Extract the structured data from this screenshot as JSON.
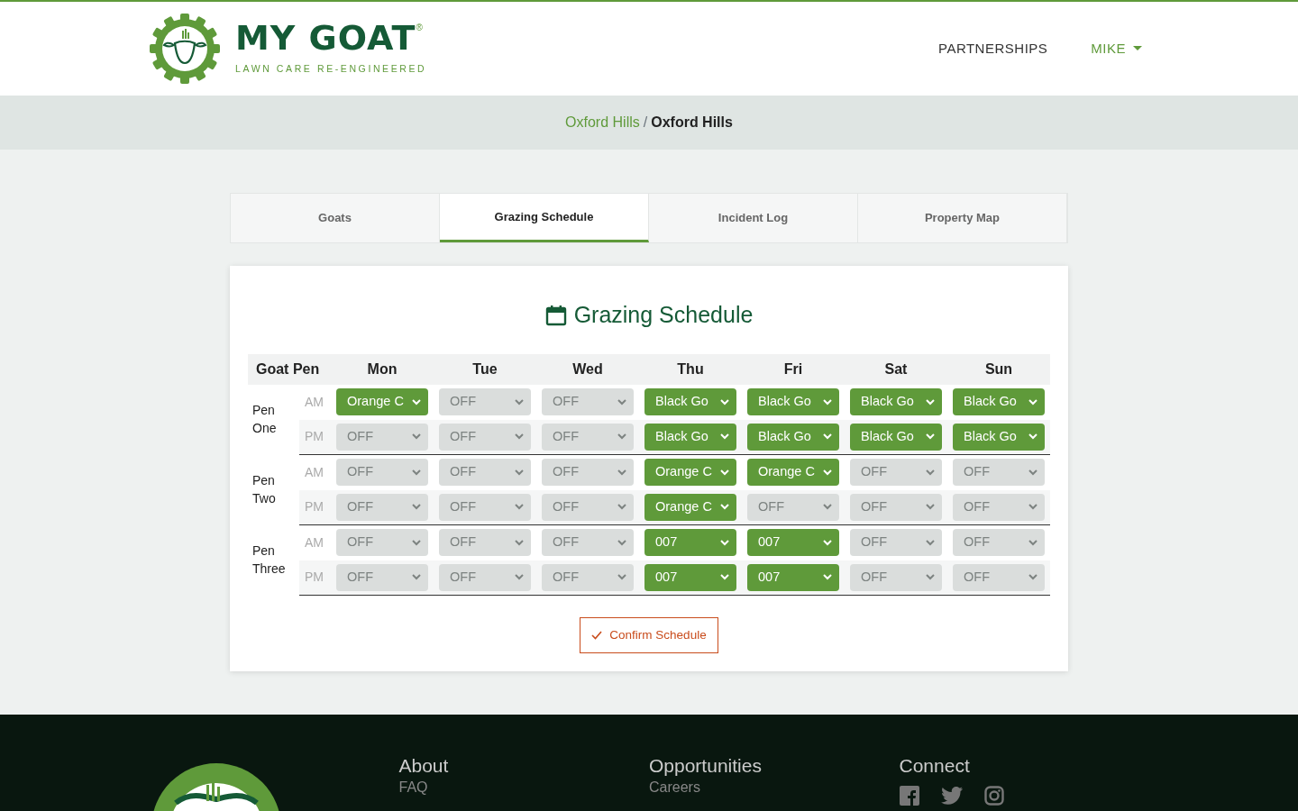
{
  "brand": {
    "name": "MY GOAT",
    "registered": "®",
    "tagline": "LAWN CARE RE-ENGINEERED"
  },
  "nav": [
    {
      "label": "PARTNERSHIPS",
      "kind": "link"
    },
    {
      "label": "MIKE",
      "kind": "dropdown"
    }
  ],
  "breadcrumb": [
    {
      "label": "Oxford Hills",
      "kind": "link"
    },
    {
      "label": "/",
      "kind": "separator"
    },
    {
      "label": "Oxford Hills",
      "kind": "current"
    }
  ],
  "tabs": [
    {
      "label": "Goats",
      "selected": false
    },
    {
      "label": "Grazing Schedule",
      "selected": true
    },
    {
      "label": "Incident Log",
      "selected": false
    },
    {
      "label": "Property Map",
      "selected": false
    }
  ],
  "schedule": {
    "title": "Grazing Schedule",
    "columns": [
      "Goat Pen",
      "Mon",
      "Tue",
      "Wed",
      "Thu",
      "Fri",
      "Sat",
      "Sun"
    ],
    "pens": [
      {
        "name": "Pen One",
        "slots": [
          {
            "period": "AM",
            "days": [
              {
                "value": "Orange C",
                "disabled": false
              },
              {
                "value": "OFF",
                "disabled": true
              },
              {
                "value": "OFF",
                "disabled": true
              },
              {
                "value": "Black Go",
                "disabled": false
              },
              {
                "value": "Black Go",
                "disabled": false
              },
              {
                "value": "Black Go",
                "disabled": false
              },
              {
                "value": "Black Go",
                "disabled": false
              }
            ]
          },
          {
            "period": "PM",
            "days": [
              {
                "value": "OFF",
                "disabled": true
              },
              {
                "value": "OFF",
                "disabled": true
              },
              {
                "value": "OFF",
                "disabled": true
              },
              {
                "value": "Black Go",
                "disabled": false
              },
              {
                "value": "Black Go",
                "disabled": false
              },
              {
                "value": "Black Go",
                "disabled": false
              },
              {
                "value": "Black Go",
                "disabled": false
              }
            ]
          }
        ]
      },
      {
        "name": "Pen Two",
        "slots": [
          {
            "period": "AM",
            "days": [
              {
                "value": "OFF",
                "disabled": true
              },
              {
                "value": "OFF",
                "disabled": true
              },
              {
                "value": "OFF",
                "disabled": true
              },
              {
                "value": "Orange C",
                "disabled": false
              },
              {
                "value": "Orange C",
                "disabled": false
              },
              {
                "value": "OFF",
                "disabled": true
              },
              {
                "value": "OFF",
                "disabled": true
              }
            ]
          },
          {
            "period": "PM",
            "days": [
              {
                "value": "OFF",
                "disabled": true
              },
              {
                "value": "OFF",
                "disabled": true
              },
              {
                "value": "OFF",
                "disabled": true
              },
              {
                "value": "Orange C",
                "disabled": false
              },
              {
                "value": "OFF",
                "disabled": true
              },
              {
                "value": "OFF",
                "disabled": true
              },
              {
                "value": "OFF",
                "disabled": true
              }
            ]
          }
        ]
      },
      {
        "name": "Pen Three",
        "slots": [
          {
            "period": "AM",
            "days": [
              {
                "value": "OFF",
                "disabled": true
              },
              {
                "value": "OFF",
                "disabled": true
              },
              {
                "value": "OFF",
                "disabled": true
              },
              {
                "value": "007",
                "disabled": false
              },
              {
                "value": "007",
                "disabled": false
              },
              {
                "value": "OFF",
                "disabled": true
              },
              {
                "value": "OFF",
                "disabled": true
              }
            ]
          },
          {
            "period": "PM",
            "days": [
              {
                "value": "OFF",
                "disabled": true
              },
              {
                "value": "OFF",
                "disabled": true
              },
              {
                "value": "OFF",
                "disabled": true
              },
              {
                "value": "007",
                "disabled": false
              },
              {
                "value": "007",
                "disabled": false
              },
              {
                "value": "OFF",
                "disabled": true
              },
              {
                "value": "OFF",
                "disabled": true
              }
            ]
          }
        ]
      }
    ],
    "confirm": "Confirm Schedule"
  },
  "footer": {
    "columns": [
      {
        "heading": "About",
        "links": [
          "FAQ"
        ]
      },
      {
        "heading": "Opportunities",
        "links": [
          "Careers"
        ]
      },
      {
        "heading": "Connect",
        "kind": "social"
      }
    ]
  }
}
